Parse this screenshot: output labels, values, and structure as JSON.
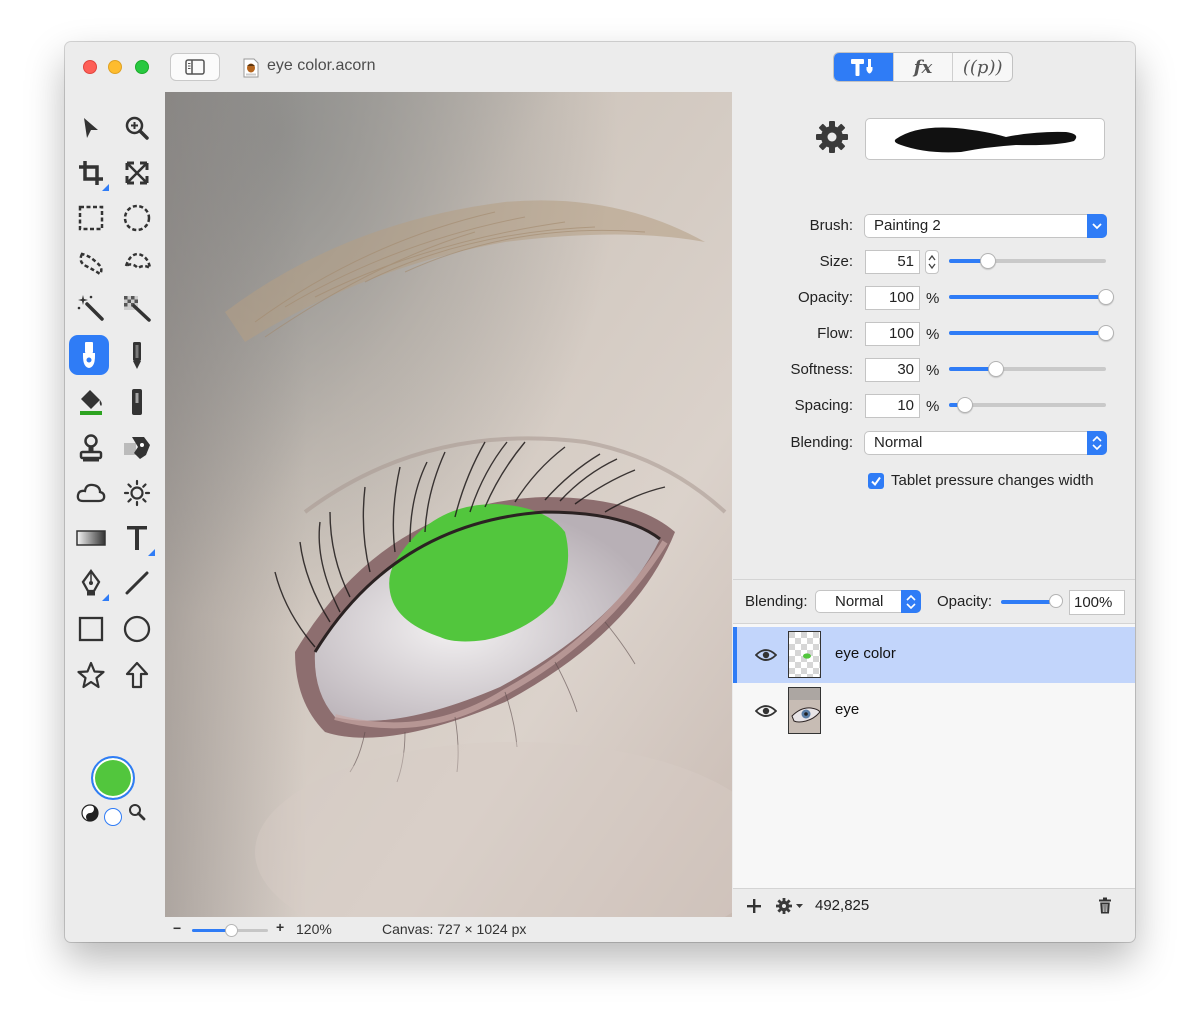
{
  "window": {
    "document_title": "eye color.acorn",
    "doc_icon": "acorn-doc-icon"
  },
  "toolbar_segments": [
    {
      "name": "tools-tab",
      "label": "",
      "icon": "hammer-brush-icon",
      "active": true
    },
    {
      "name": "effects-tab",
      "label": "fx",
      "active": false
    },
    {
      "name": "properties-tab",
      "label": "p",
      "active": false
    }
  ],
  "tools": {
    "active_tool": "brush-tool",
    "foreground_color": "#52c63d",
    "background_color": "#ffffff"
  },
  "canvas": {
    "image_subject": "close-up of an eye with the iris painted green",
    "paint_color": "#52c63d"
  },
  "statusbar": {
    "zoom_minus": "−",
    "zoom_plus": "+",
    "zoom_level": "120%",
    "zoom_slider_value": 0.52,
    "canvas_size": "Canvas: 727 × 1024 px"
  },
  "brush_inspector": {
    "brush_label": "Brush:",
    "brush_value": "Painting 2",
    "size_label": "Size:",
    "size_value": "51",
    "size_slider": 0.25,
    "opacity_label": "Opacity:",
    "opacity_value": "100",
    "opacity_slider": 1.0,
    "flow_label": "Flow:",
    "flow_value": "100",
    "flow_slider": 1.0,
    "softness_label": "Softness:",
    "softness_value": "30",
    "softness_slider": 0.3,
    "spacing_label": "Spacing:",
    "spacing_value": "10",
    "spacing_slider": 0.1,
    "percent": "%",
    "blending_label": "Blending:",
    "blending_value": "Normal",
    "tablet_pressure_label": "Tablet pressure changes width",
    "tablet_pressure_checked": true
  },
  "layers_panel": {
    "blending_label": "Blending:",
    "blending_value": "Normal",
    "opacity_label": "Opacity:",
    "opacity_value": "100%",
    "opacity_slider": 1.0,
    "layers": [
      {
        "name": "eye color",
        "visible": true,
        "selected": true
      },
      {
        "name": "eye",
        "visible": true,
        "selected": false
      }
    ],
    "footer_count": "492,825"
  },
  "colors": {
    "accent": "#2f7cf6",
    "selection": "#c2d5fb",
    "paint_green": "#52c63d"
  }
}
